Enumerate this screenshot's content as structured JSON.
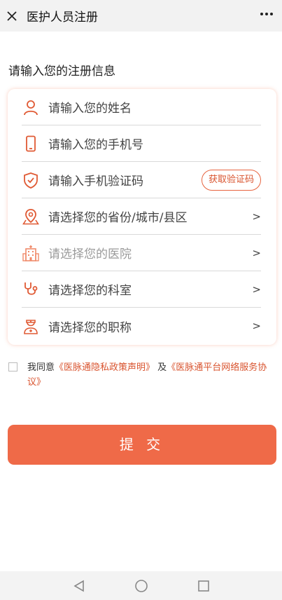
{
  "header": {
    "title": "医护人员注册"
  },
  "form": {
    "section_title": "请输入您的注册信息",
    "fields": [
      {
        "label": "请输入您的姓名",
        "icon": "user-icon"
      },
      {
        "label": "请输入您的手机号",
        "icon": "phone-icon"
      },
      {
        "label": "请输入手机验证码",
        "icon": "shield-check-icon",
        "button": "获取验证码"
      },
      {
        "label": "请选择您的省份/城市/县区",
        "icon": "location-icon",
        "arrow": ">"
      },
      {
        "label": "请选择您的医院",
        "icon": "hospital-icon",
        "arrow": ">"
      },
      {
        "label": "请选择您的科室",
        "icon": "stethoscope-icon",
        "arrow": ">"
      },
      {
        "label": "请选择您的职称",
        "icon": "doctor-icon",
        "arrow": ">"
      }
    ]
  },
  "agreement": {
    "prefix": "我同意",
    "link1": "《医脉通隐私政策声明》",
    "conj": "及",
    "link2": "《医脉通平台网络服务协议》"
  },
  "submit_label": "提 交",
  "colors": {
    "accent": "#ef6a48",
    "icon": "#e05a34"
  }
}
